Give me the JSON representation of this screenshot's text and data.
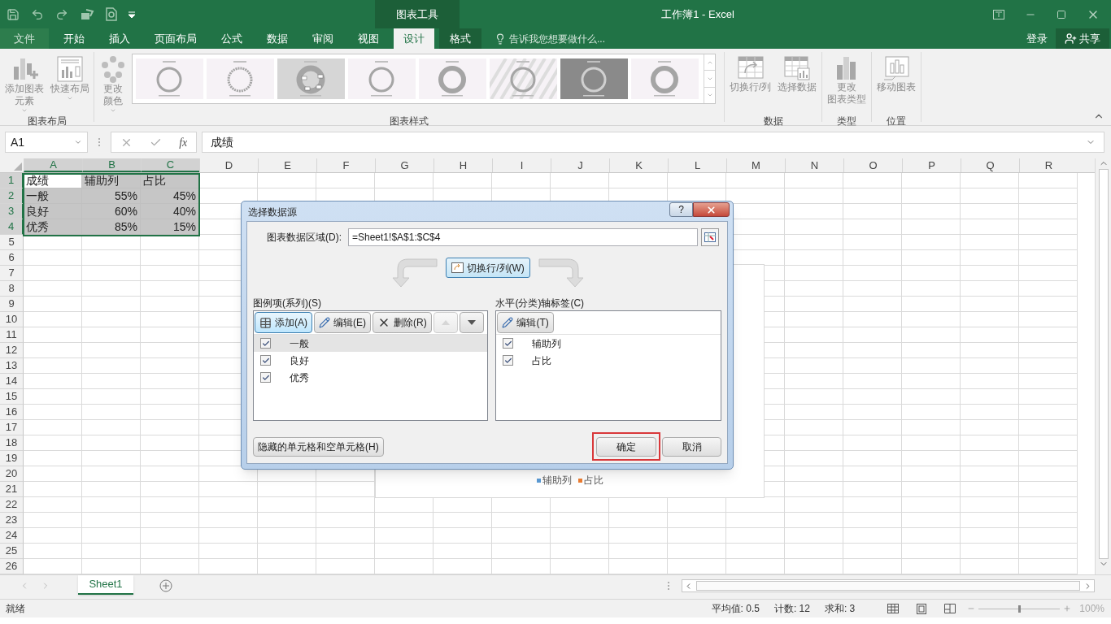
{
  "title_bar": {
    "context_tab": "图表工具",
    "title": "工作簿1 - Excel"
  },
  "tabs": [
    {
      "label": "文件",
      "kind": "file",
      "selected": false
    },
    {
      "label": "开始",
      "kind": "tab",
      "selected": false
    },
    {
      "label": "插入",
      "kind": "tab",
      "selected": false
    },
    {
      "label": "页面布局",
      "kind": "tab",
      "selected": false
    },
    {
      "label": "公式",
      "kind": "tab",
      "selected": false
    },
    {
      "label": "数据",
      "kind": "tab",
      "selected": false
    },
    {
      "label": "审阅",
      "kind": "tab",
      "selected": false
    },
    {
      "label": "视图",
      "kind": "tab",
      "selected": false
    },
    {
      "label": "设计",
      "kind": "context",
      "selected": true
    },
    {
      "label": "格式",
      "kind": "context",
      "selected": false
    }
  ],
  "tell_me": "告诉我您想要做什么...",
  "account": {
    "sign_in": "登录",
    "share": "共享"
  },
  "ribbon": {
    "layout_group": {
      "label": "图表布局",
      "buttons": [
        {
          "lines": [
            "添加图表",
            "元素"
          ],
          "kind": "add-element",
          "disabled": true,
          "dropdown": true
        },
        {
          "lines": [
            "快速布局"
          ],
          "kind": "quick-layout",
          "disabled": true,
          "dropdown": true
        }
      ]
    },
    "styles_group": {
      "label": "图表样式",
      "colors": {
        "lines": [
          "更改",
          "颜色"
        ],
        "kind": "colors",
        "disabled": true,
        "dropdown": true
      },
      "styles": [
        {
          "kind": "plain",
          "selected": false
        },
        {
          "kind": "hatched",
          "selected": false
        },
        {
          "kind": "shadow",
          "selected": false
        },
        {
          "kind": "plain",
          "selected": false
        },
        {
          "kind": "thick",
          "selected": false
        },
        {
          "kind": "striped",
          "selected": false
        },
        {
          "kind": "dark",
          "selected": false
        },
        {
          "kind": "donut",
          "selected": false
        }
      ]
    },
    "other_groups": [
      {
        "label": "数据",
        "buttons": [
          {
            "lines": [
              "切换行/列"
            ],
            "kind": "switch",
            "disabled": true,
            "dropdown": false
          },
          {
            "lines": [
              "选择数据"
            ],
            "kind": "select-data",
            "disabled": true,
            "dropdown": false
          }
        ]
      },
      {
        "label": "类型",
        "buttons": [
          {
            "lines": [
              "更改",
              "图表类型"
            ],
            "kind": "change-type",
            "disabled": true,
            "dropdown": false
          }
        ]
      },
      {
        "label": "位置",
        "buttons": [
          {
            "lines": [
              "移动图表"
            ],
            "kind": "move",
            "disabled": true,
            "dropdown": false
          }
        ]
      }
    ]
  },
  "formula_bar": {
    "name_box": "A1",
    "function_button": "fx",
    "formula": "成绩"
  },
  "grid": {
    "columns": [
      {
        "label": "A",
        "selected": true
      },
      {
        "label": "B",
        "selected": true
      },
      {
        "label": "C",
        "selected": true
      },
      {
        "label": "D",
        "selected": false
      },
      {
        "label": "E",
        "selected": false
      },
      {
        "label": "F",
        "selected": false
      },
      {
        "label": "G",
        "selected": false
      },
      {
        "label": "H",
        "selected": false
      },
      {
        "label": "I",
        "selected": false
      },
      {
        "label": "J",
        "selected": false
      },
      {
        "label": "K",
        "selected": false
      },
      {
        "label": "L",
        "selected": false
      },
      {
        "label": "M",
        "selected": false
      },
      {
        "label": "N",
        "selected": false
      },
      {
        "label": "O",
        "selected": false
      },
      {
        "label": "P",
        "selected": false
      },
      {
        "label": "Q",
        "selected": false
      },
      {
        "label": "R",
        "selected": false
      }
    ],
    "rows": [
      {
        "number": "1",
        "selected": true,
        "cells": [
          {
            "text": "成绩",
            "kind": "text",
            "selected": false
          },
          {
            "text": "辅助列",
            "kind": "text",
            "selected": true
          },
          {
            "text": "占比",
            "kind": "text",
            "selected": true
          }
        ]
      },
      {
        "number": "2",
        "selected": true,
        "cells": [
          {
            "text": "一般",
            "kind": "text",
            "selected": true
          },
          {
            "text": "55%",
            "kind": "number",
            "selected": true
          },
          {
            "text": "45%",
            "kind": "number",
            "selected": true
          }
        ]
      },
      {
        "number": "3",
        "selected": true,
        "cells": [
          {
            "text": "良好",
            "kind": "text",
            "selected": true
          },
          {
            "text": "60%",
            "kind": "number",
            "selected": true
          },
          {
            "text": "40%",
            "kind": "number",
            "selected": true
          }
        ]
      },
      {
        "number": "4",
        "selected": true,
        "cells": [
          {
            "text": "优秀",
            "kind": "text",
            "selected": true
          },
          {
            "text": "85%",
            "kind": "number",
            "selected": true
          },
          {
            "text": "15%",
            "kind": "number",
            "selected": true
          }
        ]
      },
      {
        "number": "5",
        "selected": false
      },
      {
        "number": "6",
        "selected": false
      },
      {
        "number": "7",
        "selected": false
      },
      {
        "number": "8",
        "selected": false
      },
      {
        "number": "9",
        "selected": false
      },
      {
        "number": "10",
        "selected": false
      },
      {
        "number": "11",
        "selected": false
      },
      {
        "number": "12",
        "selected": false
      },
      {
        "number": "13",
        "selected": false
      },
      {
        "number": "14",
        "selected": false
      },
      {
        "number": "15",
        "selected": false
      },
      {
        "number": "16",
        "selected": false
      },
      {
        "number": "17",
        "selected": false
      },
      {
        "number": "18",
        "selected": false
      },
      {
        "number": "19",
        "selected": false
      },
      {
        "number": "20",
        "selected": false
      },
      {
        "number": "21",
        "selected": false
      },
      {
        "number": "22",
        "selected": false
      },
      {
        "number": "23",
        "selected": false
      },
      {
        "number": "24",
        "selected": false
      },
      {
        "number": "25",
        "selected": false
      },
      {
        "number": "26",
        "selected": false
      }
    ]
  },
  "chart": {
    "legend": [
      {
        "label": "辅助列",
        "color": "#5b9bd5"
      },
      {
        "label": "占比",
        "color": "#ed7d31"
      }
    ]
  },
  "dialog": {
    "title": "选择数据源",
    "help": "?",
    "range_label": "图表数据区域(D):",
    "range_value": "=Sheet1!$A$1:$C$4",
    "switch_button": "切换行/列(W)",
    "series_panel": {
      "title": "图例项(系列)(S)",
      "buttons": [
        {
          "label": "添加(A)",
          "kind": "add",
          "disabled": false,
          "focused": true
        },
        {
          "label": "编辑(E)",
          "kind": "edit",
          "disabled": false,
          "focused": false
        },
        {
          "label": "删除(R)",
          "kind": "delete",
          "disabled": false,
          "focused": false
        },
        {
          "kind": "up",
          "disabled": true,
          "focused": false
        },
        {
          "kind": "down",
          "disabled": false,
          "focused": false
        }
      ],
      "items": [
        {
          "label": "一般",
          "checked": true,
          "selected": true
        },
        {
          "label": "良好",
          "checked": true,
          "selected": false
        },
        {
          "label": "优秀",
          "checked": true,
          "selected": false
        }
      ]
    },
    "axis_panel": {
      "title": "水平(分类)轴标签(C)",
      "buttons": [
        {
          "label": "编辑(T)",
          "kind": "edit",
          "disabled": false,
          "focused": false
        }
      ],
      "items": [
        {
          "label": "辅助列",
          "checked": true,
          "selected": false
        },
        {
          "label": "占比",
          "checked": true,
          "selected": false
        }
      ]
    },
    "hidden_cells_button": "隐藏的单元格和空单元格(H)",
    "ok_button": {
      "label": "确定",
      "highlighted": true
    },
    "cancel_button": "取消"
  },
  "sheet_tabs": [
    {
      "label": "Sheet1",
      "selected": true
    }
  ],
  "status_bar": {
    "status": "就绪",
    "stats": [
      "平均值: 0.5",
      "计数: 12",
      "求和: 3"
    ],
    "zoom": {
      "level": 0.5,
      "reading": "100%"
    }
  }
}
